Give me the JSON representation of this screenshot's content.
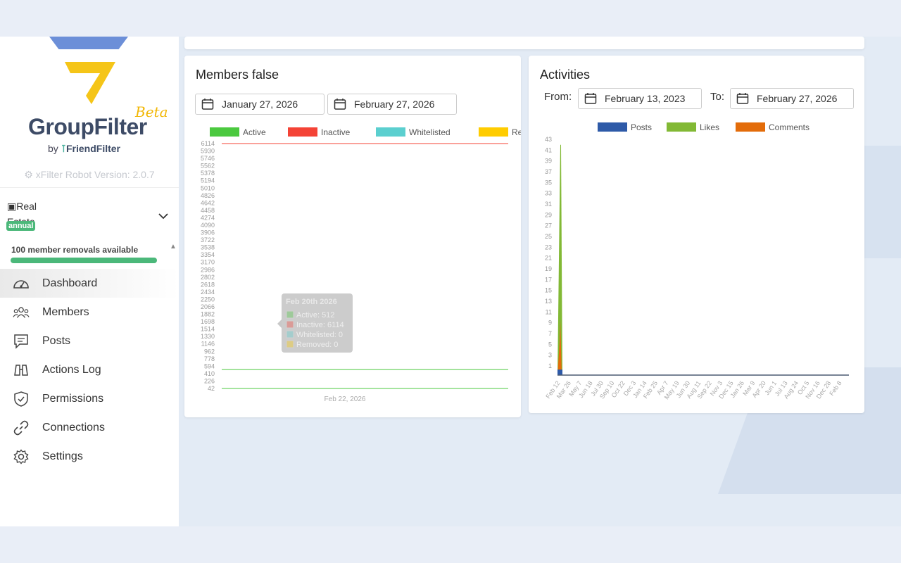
{
  "brand": {
    "name": "GroupFilter",
    "beta": "Beta",
    "by": "by",
    "by_brand": "FriendFilter",
    "version": "xFilter Robot Version: 2.0.7"
  },
  "group": {
    "image_alt": "Real Estate",
    "badge": "annual",
    "removals": "100 member removals available",
    "removals_progress": 1.0
  },
  "nav": [
    {
      "label": "Dashboard",
      "icon": "gauge-icon"
    },
    {
      "label": "Members",
      "icon": "users-icon"
    },
    {
      "label": "Posts",
      "icon": "message-icon"
    },
    {
      "label": "Actions Log",
      "icon": "binoculars-icon"
    },
    {
      "label": "Permissions",
      "icon": "shield-icon"
    },
    {
      "label": "Connections",
      "icon": "link-icon"
    },
    {
      "label": "Settings",
      "icon": "gear-icon"
    }
  ],
  "members_card": {
    "title": "Members false",
    "date_from": "January 27, 2026",
    "date_to": "February 27, 2026",
    "tooltip": {
      "title": "Feb 20th 2026",
      "lines": [
        "Active: 512",
        "Inactive: 6114",
        "Whitelisted: 0",
        "Removed: 0"
      ]
    }
  },
  "activities_card": {
    "title": "Activities",
    "from_label": "From:",
    "to_label": "To:",
    "date_from": "February 13, 2023",
    "date_to": "February 27, 2026"
  },
  "colors": {
    "active": "#4bc93f",
    "inactive": "#f44336",
    "whitelisted": "#5bcfcf",
    "removed": "#ffcc00",
    "posts": "#2e5aa8",
    "likes": "#82b935",
    "comments": "#e36c0a",
    "accent": "#4bb87a"
  },
  "chart_data": [
    {
      "type": "line",
      "legend": [
        "Active",
        "Inactive",
        "Whitelisted",
        "Removed"
      ],
      "legend_position": "top",
      "x": [
        "Feb 22, 2026"
      ],
      "y_ticks": [
        6114,
        5930,
        5746,
        5562,
        5378,
        5194,
        5010,
        4826,
        4642,
        4458,
        4274,
        4090,
        3906,
        3722,
        3538,
        3354,
        3170,
        2986,
        2802,
        2618,
        2434,
        2250,
        2066,
        1882,
        1698,
        1514,
        1330,
        1146,
        962,
        778,
        594,
        410,
        226,
        42
      ],
      "ylim": [
        42,
        6114
      ],
      "series": [
        {
          "name": "Active",
          "values": [
            512
          ]
        },
        {
          "name": "Inactive",
          "values": [
            6114
          ]
        },
        {
          "name": "Whitelisted",
          "values": [
            0
          ]
        },
        {
          "name": "Removed",
          "values": [
            0
          ]
        }
      ]
    },
    {
      "type": "area",
      "legend": [
        "Posts",
        "Likes",
        "Comments"
      ],
      "legend_position": "top",
      "x_ticks": [
        "Feb 12",
        "Mar 26",
        "May 7",
        "Jun 18",
        "Jul 30",
        "Sep 10",
        "Oct 22",
        "Dec 3",
        "Jan 14",
        "Feb 25",
        "Apr 7",
        "May 19",
        "Jun 30",
        "Aug 11",
        "Sep 22",
        "Nov 3",
        "Dec 15",
        "Jan 26",
        "Mar 9",
        "Apr 20",
        "Jun 1",
        "Jul 13",
        "Aug 24",
        "Oct 5",
        "Nov 16",
        "Dec 28",
        "Feb 8"
      ],
      "y_ticks": [
        43,
        41,
        39,
        37,
        35,
        33,
        31,
        29,
        27,
        25,
        23,
        21,
        19,
        17,
        15,
        13,
        11,
        9,
        7,
        5,
        3,
        1
      ],
      "ylim": [
        0,
        43
      ],
      "series": [
        {
          "name": "Posts",
          "values": [
            1,
            0
          ]
        },
        {
          "name": "Likes",
          "values": [
            42,
            0
          ]
        },
        {
          "name": "Comments",
          "values": [
            6,
            0
          ]
        }
      ]
    }
  ]
}
